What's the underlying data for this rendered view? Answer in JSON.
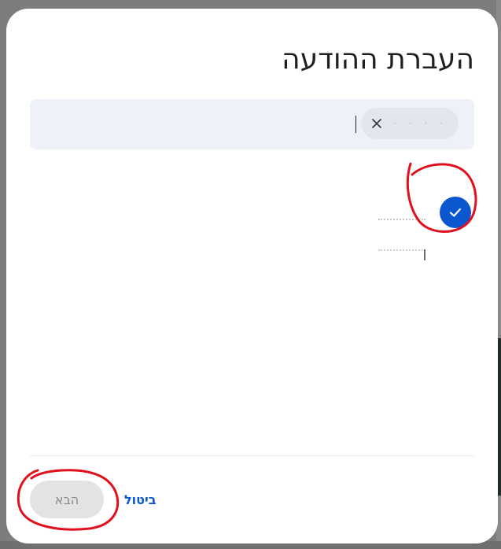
{
  "dialog": {
    "title": "העברת ההודעה",
    "recipient_chip": {
      "name": "· · · ·",
      "remove_icon": "close-icon"
    },
    "selected_item": {
      "checked": true,
      "check_icon": "check-icon"
    },
    "actions": {
      "cancel_label": "ביטול",
      "next_label": "הבא",
      "next_enabled": false
    }
  },
  "colors": {
    "accent": "#0b57d0",
    "field_bg": "#eef1f7",
    "annotation": "#e0101e"
  }
}
